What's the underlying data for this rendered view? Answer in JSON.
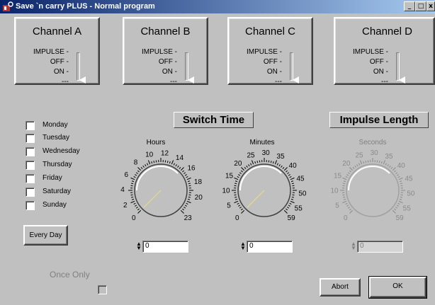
{
  "window": {
    "title": "Save `n carry PLUS - Normal program",
    "min_label": "_",
    "max_label": "□",
    "close_label": "x"
  },
  "channels": [
    {
      "name": "Channel A",
      "impulse": "IMPULSE -",
      "off": "OFF -",
      "on": "ON -",
      "dash": "---"
    },
    {
      "name": "Channel B",
      "impulse": "IMPULSE -",
      "off": "OFF -",
      "on": "ON -",
      "dash": "---"
    },
    {
      "name": "Channel C",
      "impulse": "IMPULSE -",
      "off": "OFF -",
      "on": "ON -",
      "dash": "---"
    },
    {
      "name": "Channel D",
      "impulse": "IMPULSE -",
      "off": "OFF -",
      "on": "ON -",
      "dash": "---"
    }
  ],
  "days": [
    {
      "label": "Monday",
      "checked": false
    },
    {
      "label": "Tuesday",
      "checked": false
    },
    {
      "label": "Wednesday",
      "checked": false
    },
    {
      "label": "Thursday",
      "checked": false
    },
    {
      "label": "Friday",
      "checked": false
    },
    {
      "label": "Saturday",
      "checked": false
    },
    {
      "label": "Sunday",
      "checked": false
    }
  ],
  "every_day_label": "Every Day",
  "switch_time_label": "Switch Time",
  "impulse_length_label": "Impulse Length",
  "dials": {
    "hours": {
      "label": "Hours",
      "ticks": [
        "0",
        "2",
        "4",
        "6",
        "8",
        "10",
        "12",
        "14",
        "16",
        "18",
        "20",
        "23"
      ],
      "value": "0",
      "enabled": true
    },
    "minutes": {
      "label": "Minutes",
      "ticks": [
        "0",
        "5",
        "10",
        "15",
        "20",
        "25",
        "30",
        "35",
        "40",
        "45",
        "50",
        "55",
        "59"
      ],
      "value": "0",
      "enabled": true
    },
    "seconds": {
      "label": "Seconds",
      "ticks": [
        "0",
        "5",
        "10",
        "15",
        "20",
        "25",
        "30",
        "35",
        "40",
        "45",
        "50",
        "55",
        "59"
      ],
      "value": "0",
      "enabled": false
    }
  },
  "once_only_label": "Once Only",
  "abort_label": "Abort",
  "ok_label": "OK",
  "colors": {
    "title_bar": "#0a246a",
    "face": "#c0c0c0",
    "needle": "#e8e070"
  }
}
